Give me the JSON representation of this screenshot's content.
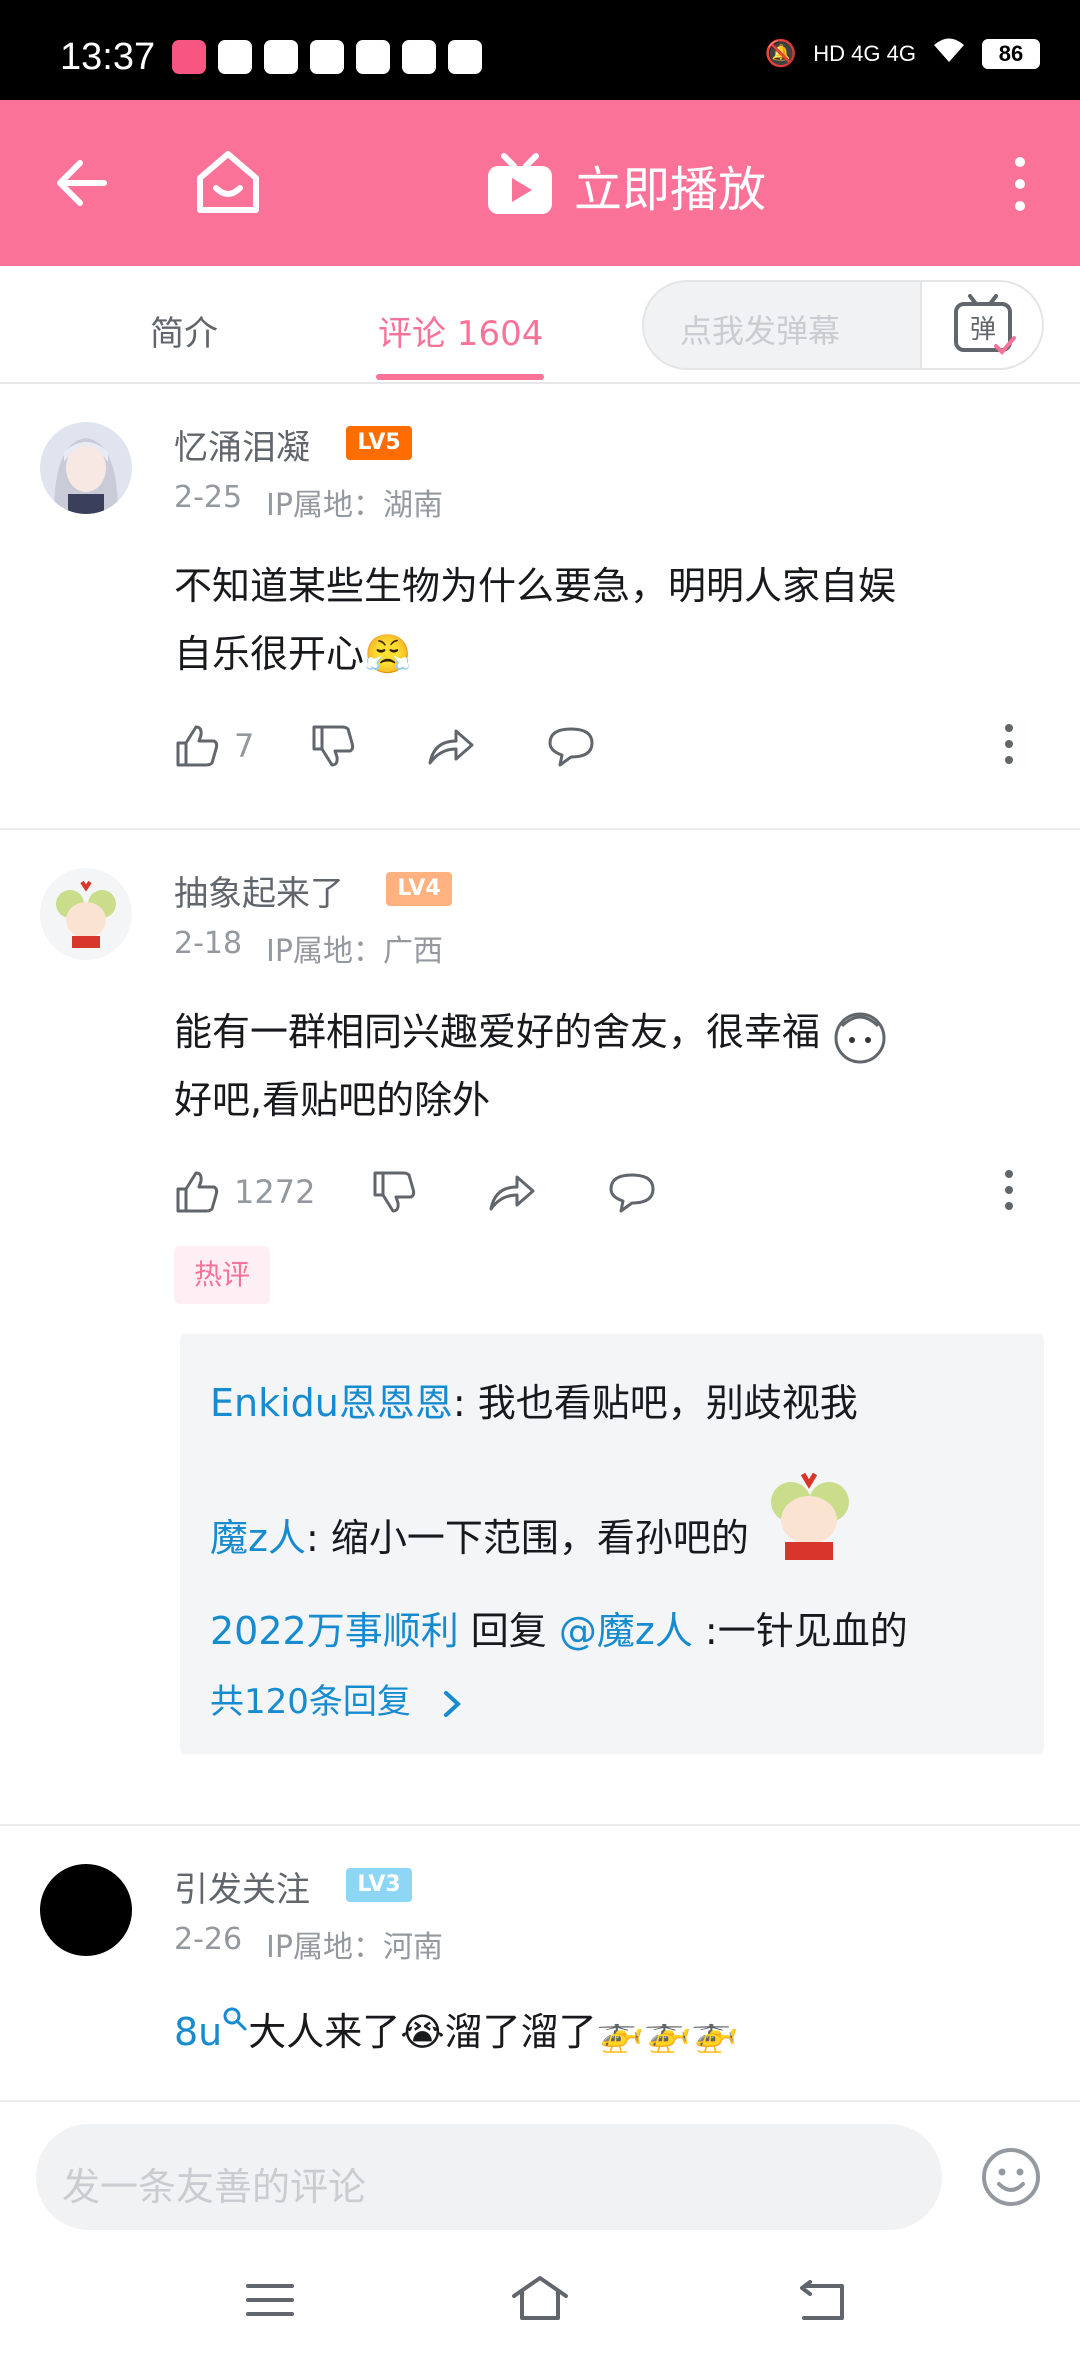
{
  "status_bar": {
    "time": "13:37",
    "network": "HD 4G 4G",
    "battery": "86"
  },
  "top_bar": {
    "play_label": "立即播放"
  },
  "tabs": {
    "intro": "简介",
    "comments": "评论 1604",
    "danmaku_placeholder": "点我发弹幕",
    "danmaku_button": "弹"
  },
  "comments": [
    {
      "username": "忆涌泪凝",
      "level": "LV5",
      "level_color": "#ff6c00",
      "date": "2-25",
      "ip": "IP属地：湖南",
      "text_line1": "不知道某些生物为什么要急，明明人家自娱",
      "text_line2": "自乐很开心",
      "emoji": "😤",
      "likes": "7"
    },
    {
      "username": "抽象起来了",
      "level": "LV4",
      "level_color": "#ffb27f",
      "date": "2-18",
      "ip": "IP属地：广西",
      "text_line1": "能有一群相同兴趣爱好的舍友，很幸福",
      "text_line2": "好吧,看贴吧的除外",
      "likes": "1272",
      "hot_badge": "热评",
      "replies": [
        {
          "who": "Enkidu恩恩恩",
          "text": ": 我也看贴吧，别歧视我"
        },
        {
          "who": "魔z人",
          "text": ": 缩小一下范围，看孙吧的"
        },
        {
          "who": "2022万事顺利",
          "mid": " 回复 ",
          "at": "@魔z人",
          "text": " :一针见血的"
        }
      ],
      "more_replies": "共120条回复"
    },
    {
      "username": "引发关注",
      "level": "LV3",
      "level_color": "#8ed6f5",
      "date": "2-26",
      "ip": "IP属地：河南",
      "link": "8u",
      "text_line1": "大人来了😭溜了溜了🚁🚁🚁"
    }
  ],
  "bottom": {
    "input_placeholder": "发一条友善的评论"
  }
}
